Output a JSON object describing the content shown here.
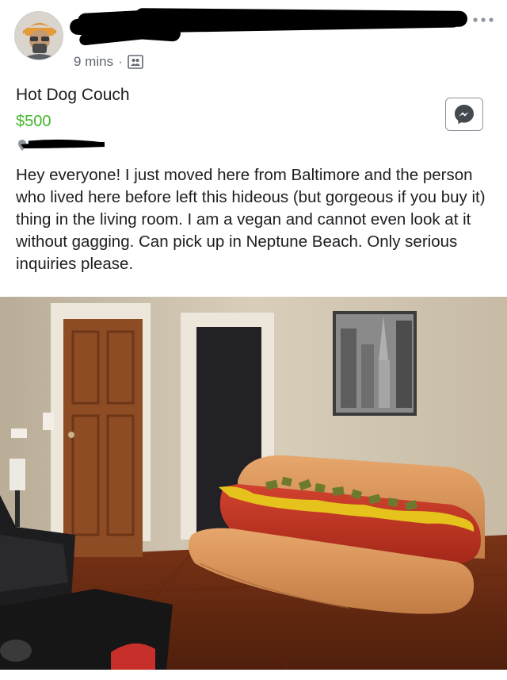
{
  "post": {
    "time": "9 mins",
    "separator": "·",
    "more_icon": "more-horizontal-icon",
    "audience_icon": "audience-icon"
  },
  "listing": {
    "title": "Hot Dog Couch",
    "price": "$500",
    "description": "Hey everyone! I just moved here from Baltimore and the person who lived here before left this hideous (but gorgeous if you buy it) thing in the living room. I am a vegan and cannot even look at it without gagging. Can pick up in Neptune Beach. Only serious inquiries please.",
    "message_icon": "messenger-icon"
  },
  "colors": {
    "price_green": "#42b72a",
    "meta_gray": "#616770",
    "text": "#1c1e21"
  }
}
